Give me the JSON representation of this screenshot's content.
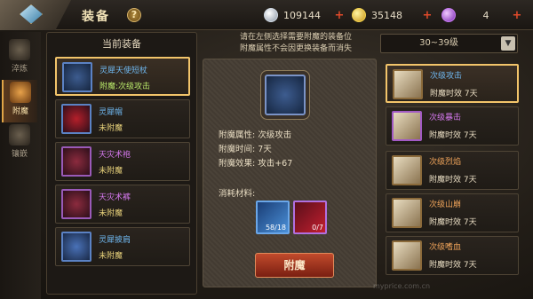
{
  "header": {
    "title": "装备",
    "help": "?"
  },
  "resources": [
    {
      "icon": "silver-coin-icon",
      "value": "109144"
    },
    {
      "icon": "gold-coin-icon",
      "value": "35148"
    },
    {
      "icon": "purple-orb-icon",
      "value": "4"
    }
  ],
  "tabs": [
    {
      "label": "淬炼"
    },
    {
      "label": "附魔"
    },
    {
      "label": "镶嵌"
    }
  ],
  "equipment": {
    "heading": "当前装备",
    "items": [
      {
        "name": "灵犀天使短杖",
        "status": "附魔:次级攻击"
      },
      {
        "name": "灵犀帽",
        "status": "未附魔"
      },
      {
        "name": "天灾术袍",
        "status": "未附魔"
      },
      {
        "name": "天灾术裤",
        "status": "未附魔"
      },
      {
        "name": "灵犀披肩",
        "status": "未附魔"
      }
    ]
  },
  "detail": {
    "tip_line1": "请在左侧选择需要附魔的装备位",
    "tip_line2": "附魔属性不会因更换装备而消失",
    "attr": "附魔属性: 次级攻击",
    "time": "附魔时间: 7天",
    "effect": "附魔效果: 攻击+67",
    "materials_label": "消耗材料:",
    "mat_a_count": "58/18",
    "mat_b_count": "0/7",
    "button": "附魔"
  },
  "level_select": {
    "value": "30~39级"
  },
  "scrolls": [
    {
      "name": "次级攻击",
      "desc": "附魔时效 7天"
    },
    {
      "name": "次级暴击",
      "desc": "附魔时效 7天"
    },
    {
      "name": "次级烈焰",
      "desc": "附魔时效 7天"
    },
    {
      "name": "次级山崩",
      "desc": "附魔时效 7天"
    },
    {
      "name": "次级嗜血",
      "desc": "附魔时效 7天"
    }
  ],
  "watermark": "myprice.com.cn"
}
